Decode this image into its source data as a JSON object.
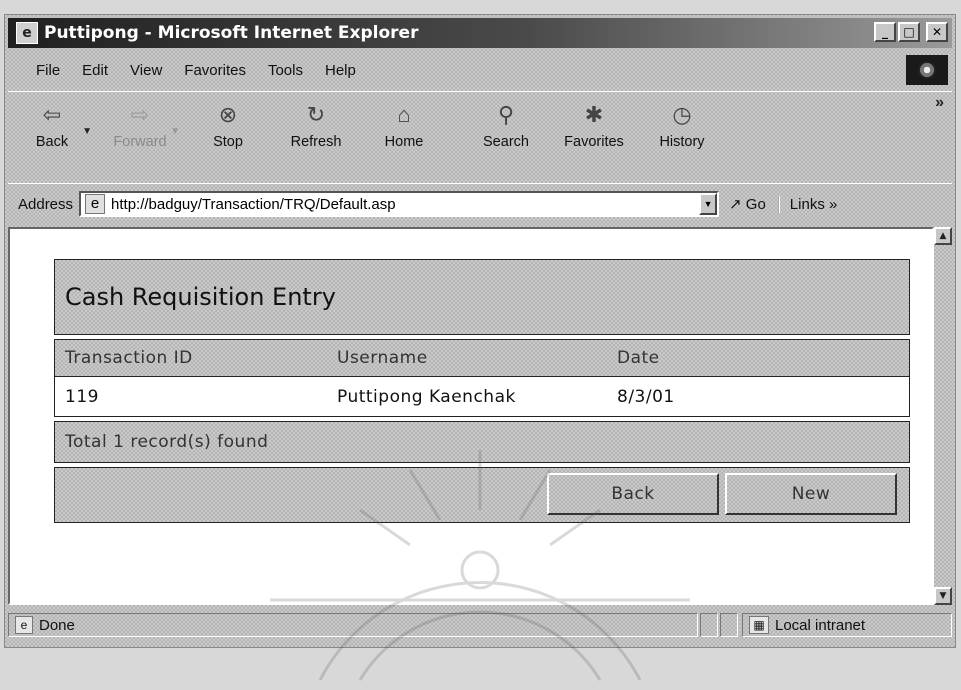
{
  "window": {
    "title": "Puttipong - Microsoft Internet Explorer",
    "app_icon": "ie-logo-icon",
    "controls": [
      "minimize-icon",
      "maximize-icon",
      "close-icon"
    ]
  },
  "menu": [
    "File",
    "Edit",
    "View",
    "Favorites",
    "Tools",
    "Help"
  ],
  "toolbar": {
    "buttons": [
      {
        "label": "Back",
        "icon": "back-arrow-icon",
        "enabled": true
      },
      {
        "label": "Forward",
        "icon": "forward-arrow-icon",
        "enabled": false
      },
      {
        "label": "Stop",
        "icon": "stop-icon",
        "enabled": true
      },
      {
        "label": "Refresh",
        "icon": "refresh-icon",
        "enabled": true
      },
      {
        "label": "Home",
        "icon": "home-icon",
        "enabled": true
      },
      {
        "label": "Search",
        "icon": "search-icon",
        "enabled": true
      },
      {
        "label": "Favorites",
        "icon": "favorites-icon",
        "enabled": true
      },
      {
        "label": "History",
        "icon": "history-icon",
        "enabled": true
      }
    ],
    "more": "»"
  },
  "address": {
    "label": "Address",
    "url": "http://badguy/Transaction/TRQ/Default.asp",
    "go": "Go",
    "links": "Links"
  },
  "form": {
    "title": "Cash Requisition Entry",
    "columns": [
      "Transaction ID",
      "Username",
      "Date"
    ],
    "rows": [
      {
        "id": "119",
        "username": "Puttipong Kaenchak",
        "date": "8/3/01"
      }
    ],
    "summary": "Total 1 record(s) found",
    "back_label": "Back",
    "new_label": "New"
  },
  "status": {
    "text": "Done",
    "zone": "Local intranet"
  },
  "colors": {
    "titlebar_start": "#202020",
    "titlebar_end": "#9a9a9a",
    "chrome": "#c9c9c9",
    "content_bg": "#ffffff"
  }
}
